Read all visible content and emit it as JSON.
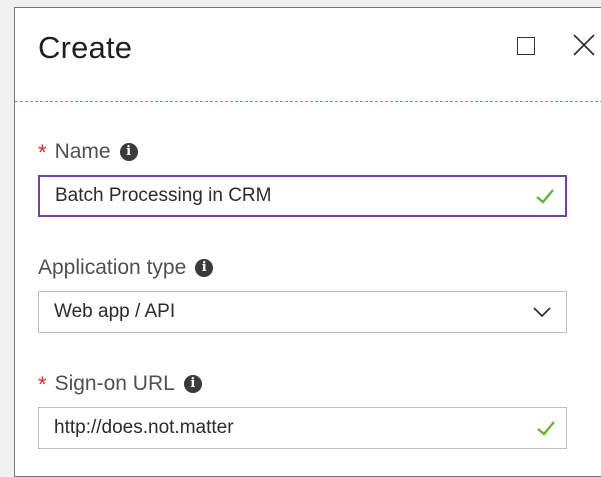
{
  "blade": {
    "title": "Create",
    "maximize_icon": "maximize-icon",
    "close_icon": "close-icon"
  },
  "form": {
    "name": {
      "label": "Name",
      "required": true,
      "value": "Batch Processing in CRM",
      "valid": true
    },
    "application_type": {
      "label": "Application type",
      "required": false,
      "selected": "Web app / API"
    },
    "sign_on_url": {
      "label": "Sign-on URL",
      "required": true,
      "value": "http://does.not.matter",
      "valid": true
    }
  },
  "colors": {
    "required_star": "#d62b2b",
    "focus_border": "#7b3f9e",
    "valid_check": "#6bb22e",
    "divider": "#4fb0d9"
  }
}
